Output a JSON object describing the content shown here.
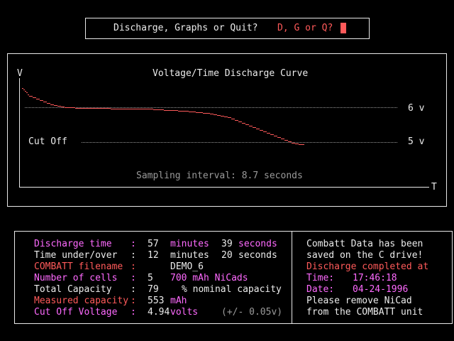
{
  "prompt": {
    "question": "Discharge, Graphs or Quit?",
    "options": "D, G or Q?"
  },
  "graph": {
    "y_axis_label": "V",
    "x_axis_label": "T",
    "title": "Voltage/Time Discharge Curve",
    "cutoff_label": "Cut Off",
    "ref_high_label": "6 v",
    "ref_low_label": "5 v",
    "sampling_text": "Sampling interval: 8.7 seconds"
  },
  "chart_data": {
    "type": "line",
    "title": "Voltage/Time Discharge Curve",
    "xlabel": "T",
    "ylabel": "V",
    "ylim": [
      4.9,
      6.5
    ],
    "grid": false,
    "reference_lines": [
      {
        "label": "6 v",
        "value": 6.0
      },
      {
        "label": "5 v",
        "value": 5.0
      }
    ],
    "series": [
      {
        "x": [
          0,
          2,
          4,
          6,
          8,
          10,
          15,
          20,
          25,
          30,
          35,
          40,
          45,
          50,
          55,
          60,
          65,
          70,
          75,
          80,
          85,
          90,
          95,
          100,
          105,
          110,
          115,
          120,
          125,
          130,
          135,
          140,
          145,
          150,
          155,
          160,
          165,
          170,
          175,
          180,
          185,
          190,
          195,
          200,
          205,
          210,
          215,
          220,
          225,
          230,
          235,
          240,
          245,
          250,
          255,
          260,
          265,
          270,
          275,
          280,
          285,
          290,
          295,
          300,
          305,
          310,
          315,
          320,
          325,
          330,
          335,
          340,
          345,
          350,
          355,
          360,
          365,
          370,
          375,
          380,
          385,
          390,
          395
        ],
        "y": [
          6.56,
          6.51,
          6.47,
          6.42,
          6.37,
          6.33,
          6.29,
          6.24,
          6.2,
          6.16,
          6.12,
          6.08,
          6.06,
          6.04,
          6.02,
          6.0,
          6.0,
          6.0,
          5.98,
          5.98,
          5.98,
          5.98,
          5.98,
          5.98,
          5.98,
          5.98,
          5.98,
          5.98,
          5.96,
          5.96,
          5.96,
          5.96,
          5.96,
          5.96,
          5.96,
          5.96,
          5.96,
          5.96,
          5.96,
          5.96,
          5.94,
          5.94,
          5.94,
          5.92,
          5.92,
          5.92,
          5.92,
          5.9,
          5.9,
          5.9,
          5.88,
          5.88,
          5.86,
          5.86,
          5.84,
          5.84,
          5.82,
          5.8,
          5.78,
          5.76,
          5.73,
          5.71,
          5.67,
          5.63,
          5.59,
          5.55,
          5.51,
          5.47,
          5.43,
          5.39,
          5.35,
          5.31,
          5.27,
          5.22,
          5.18,
          5.14,
          5.1,
          5.06,
          5.02,
          4.98,
          4.96,
          4.94,
          4.94
        ]
      }
    ]
  },
  "report": {
    "rows": [
      {
        "label": "Discharge time",
        "sep": ":",
        "v1": "57",
        "u1": "minutes",
        "v2": "39",
        "u2": "seconds"
      },
      {
        "label": "Time under/over",
        "sep": ":",
        "v1": "12",
        "u1": "minutes",
        "v2": "20",
        "u2": "seconds"
      },
      {
        "label": "COMBATT filename",
        "sep": ":",
        "v1": "DEMO_6"
      },
      {
        "label": "Number of cells",
        "sep": ":",
        "v1": "5",
        "u1": "700 mAh NiCads"
      },
      {
        "label": "Total Capacity",
        "sep": ":",
        "v1": "79",
        "u1": "% nominal capacity"
      },
      {
        "label": "Measured capacity",
        "sep": ":",
        "v1": "553",
        "u1": "mAh"
      },
      {
        "label": "Cut Off Voltage",
        "sep": ":",
        "v1": "4.94",
        "u1": "volts",
        "tol": "(+/- 0.05v)"
      }
    ],
    "status": {
      "line1": "Combatt Data has been",
      "line2": "saved on the C drive!",
      "completed": "Discharge completed at",
      "time_label": "Time:",
      "time_value": "17:46:18",
      "date_label": "Date:",
      "date_value": "04-24-1996",
      "remove1": "Please remove NiCad",
      "remove2": "from the COMBATT unit"
    }
  },
  "colors": {
    "background": "#000000",
    "text": "#e8e8e8",
    "red": "#ff5a5a",
    "magenta": "#ff6aff",
    "gray": "#9a9a9a"
  }
}
